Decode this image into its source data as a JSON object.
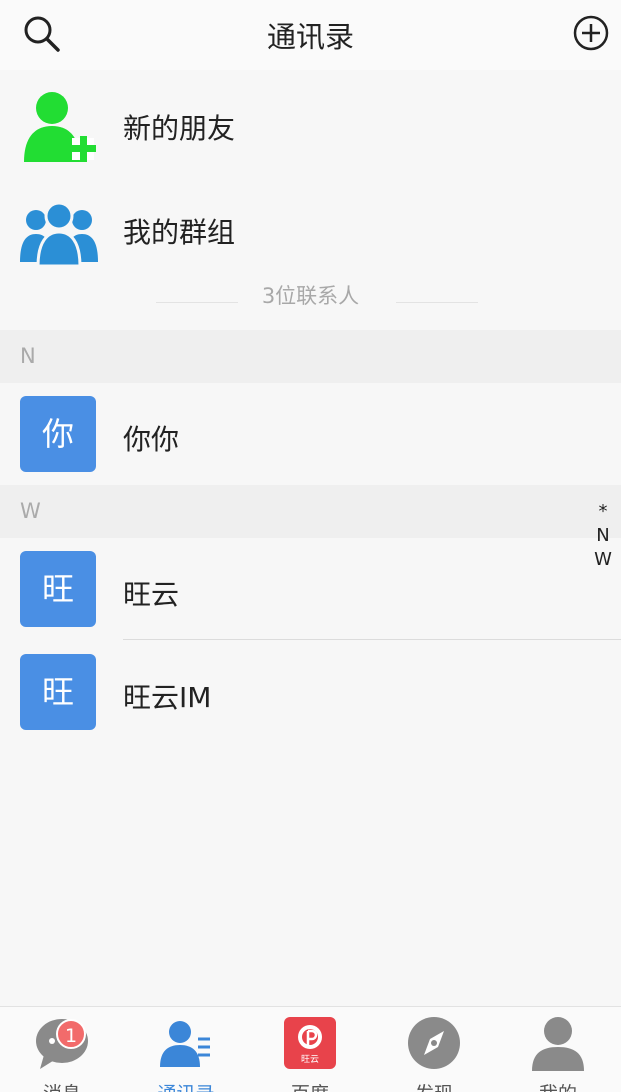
{
  "header": {
    "title": "通讯录",
    "search_icon": "search-icon",
    "add_icon": "plus-circle-icon"
  },
  "entries": [
    {
      "label": "新的朋友",
      "icon": "add-friend-icon",
      "color": "#22dd33"
    },
    {
      "label": "我的群组",
      "icon": "group-icon",
      "color": "#2b8fd6"
    }
  ],
  "contact_count": "3位联系人",
  "sections": [
    {
      "letter": "N",
      "contacts": [
        {
          "avatar": "你",
          "name": "你你"
        }
      ]
    },
    {
      "letter": "W",
      "contacts": [
        {
          "avatar": "旺",
          "name": "旺云"
        },
        {
          "avatar": "旺",
          "name": "旺云IM"
        }
      ]
    }
  ],
  "index_bar": [
    "*",
    "N",
    "W"
  ],
  "tabbar": {
    "tabs": [
      {
        "label": "消息",
        "icon": "chat-bubble-icon",
        "badge": "1"
      },
      {
        "label": "通讯录",
        "icon": "contacts-icon",
        "active": true
      },
      {
        "label": "百度",
        "icon": "baidu-app-icon",
        "icon_text": "旺云"
      },
      {
        "label": "发现",
        "icon": "compass-icon"
      },
      {
        "label": "我的",
        "icon": "person-icon"
      }
    ]
  },
  "colors": {
    "accent": "#3b86d8",
    "avatar_bg": "#4a8fe4",
    "badge": "#f26b6b",
    "new_friend_green": "#22dd33",
    "group_blue": "#2b8fd6",
    "tab_icon_gray": "#8a8a8a"
  }
}
